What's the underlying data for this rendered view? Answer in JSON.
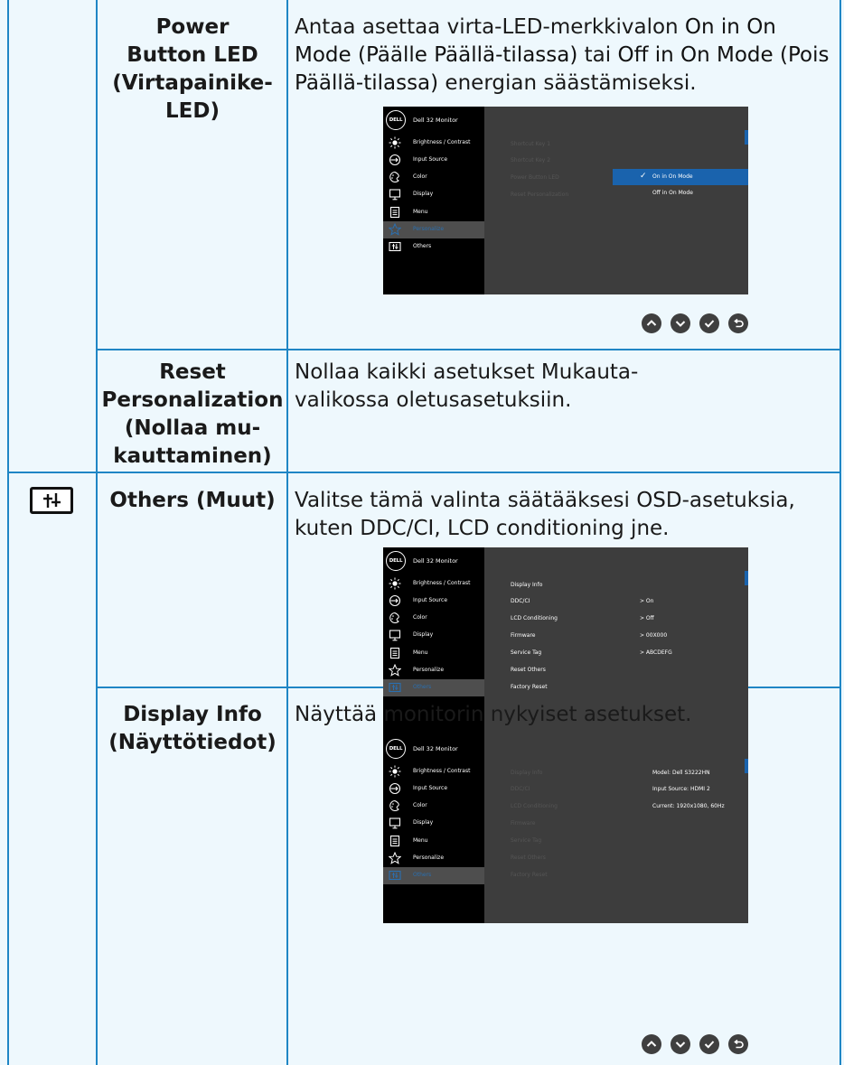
{
  "rows": [
    {
      "name": [
        "Power",
        "Button LED",
        "(Virtapainike-",
        "LED)"
      ],
      "desc_parts": [
        {
          "t": "Antaa asettaa virta-LED-merkkivalon ",
          "b": false
        },
        {
          "t": "On in On Mode (Päälle Päällä-tilassa)",
          "b": true
        },
        {
          "t": " tai ",
          "b": false
        },
        {
          "t": "Off in On Mode (Pois Päällä-tilassa)",
          "b": true
        },
        {
          "t": " energian säästämiseksi.",
          "b": false
        }
      ]
    },
    {
      "name": [
        "Reset",
        "Personalization",
        "(Nollaa mu-",
        "kauttaminen)"
      ],
      "desc": "Nollaa kaikki asetukset Mukauta-valikossa oletusasetuksiin."
    },
    {
      "name": [
        "Others (Muut)"
      ],
      "desc": "Valitse tämä valinta säätääksesi OSD-asetuksia, kuten DDC/CI, LCD conditioning jne."
    },
    {
      "name": [
        "Display Info",
        "(Näyttötiedot)"
      ],
      "desc": "Näyttää monitorin nykyiset asetukset."
    }
  ],
  "osd": {
    "logo": "DELL",
    "title": "Dell 32 Monitor",
    "menu": [
      "Brightness / Contrast",
      "Input Source",
      "Color",
      "Display",
      "Menu",
      "Personalize",
      "Others"
    ],
    "menu_icons": [
      "brightness-icon",
      "input-source-icon",
      "color-icon",
      "display-icon",
      "menu-icon",
      "star-icon",
      "others-icon"
    ]
  },
  "osd1": {
    "selected_menu": 5,
    "sub": [
      "Shortcut Key 1",
      "Shortcut Key 2",
      "Power Button LED",
      "Reset Personalization"
    ],
    "options": [
      "On in On Mode",
      "Off in On Mode"
    ],
    "check": "✓",
    "buttons": [
      "up-button-icon",
      "down-button-icon",
      "check-button-icon",
      "back-button-icon"
    ]
  },
  "osd2": {
    "selected_menu": 6,
    "sub": [
      "Display Info",
      "DDC/CI",
      "LCD Conditioning",
      "Firmware",
      "Service Tag",
      "Reset Others",
      "Factory Reset"
    ],
    "values": [
      "> On",
      "> Off",
      "> 00X000",
      "> ABCDEFG"
    ],
    "buttons": [
      "up-button-icon",
      "down-button-icon",
      "right-button-icon",
      "close-button-icon"
    ]
  },
  "osd3": {
    "selected_menu": 6,
    "sub": [
      "Display Info",
      "DDC/CI",
      "LCD Conditioning",
      "Firmware",
      "Service Tag",
      "Reset Others",
      "Factory Reset"
    ],
    "info": [
      "Model: Dell S3222HN",
      "Input Source: HDMI 2",
      "Current: 1920x1080, 60Hz"
    ],
    "buttons": [
      "up-button-icon",
      "down-button-icon",
      "check-button-icon",
      "back-button-icon"
    ]
  }
}
